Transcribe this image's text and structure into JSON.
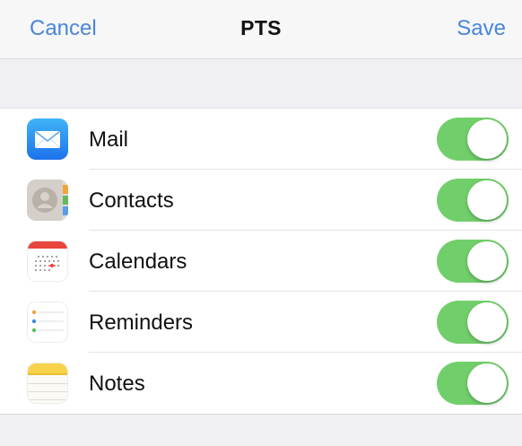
{
  "navbar": {
    "cancel_label": "Cancel",
    "title": "PTS",
    "save_label": "Save"
  },
  "accent_color": "#4a86d8",
  "toggle_on_color": "#71cf6b",
  "services": [
    {
      "label": "Mail",
      "icon": "mail-icon",
      "enabled": true
    },
    {
      "label": "Contacts",
      "icon": "contacts-icon",
      "enabled": true
    },
    {
      "label": "Calendars",
      "icon": "calendar-icon",
      "enabled": true
    },
    {
      "label": "Reminders",
      "icon": "reminders-icon",
      "enabled": true
    },
    {
      "label": "Notes",
      "icon": "notes-icon",
      "enabled": true
    }
  ]
}
